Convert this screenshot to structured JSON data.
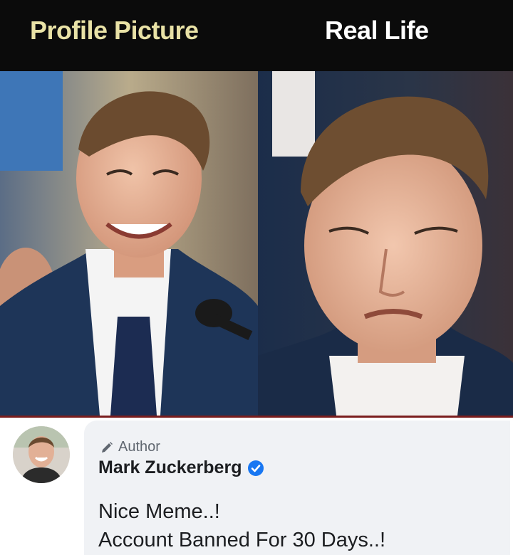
{
  "header": {
    "left_label": "Profile Picture",
    "right_label": "Real Life"
  },
  "comment": {
    "badge_label": "Author",
    "commenter_name": "Mark Zuckerberg",
    "lines": [
      "Nice Meme..!",
      "Account Banned For 30 Days..!"
    ],
    "verified_color": "#1877f2"
  },
  "icons": {
    "badge": "pencil-icon",
    "verified": "verified-check-icon"
  },
  "colors": {
    "header_bg": "#0b0b0b",
    "left_label": "#e9e2a6",
    "right_label": "#ffffff",
    "comment_bubble": "#f0f2f5"
  }
}
